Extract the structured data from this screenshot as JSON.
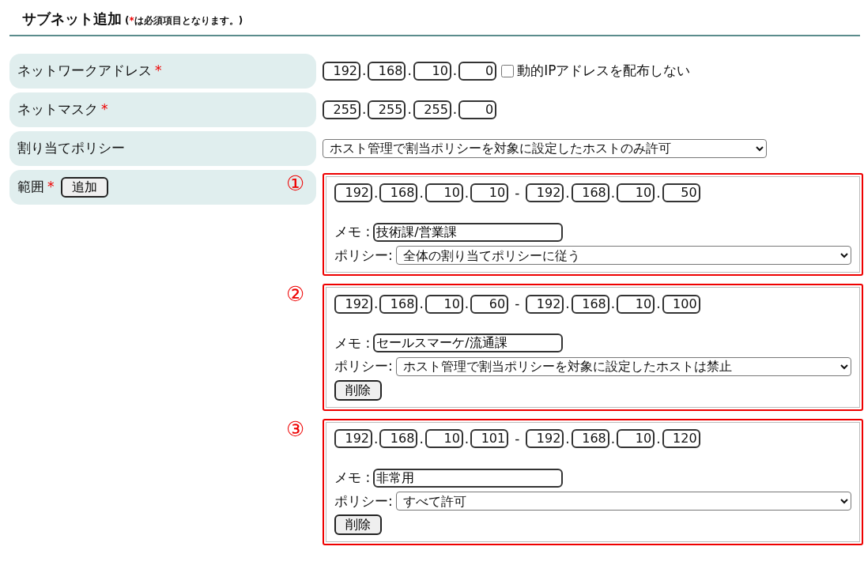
{
  "header": {
    "title": "サブネット追加",
    "note": {
      "open": "(",
      "mark": "*",
      "text": "は必須項目となります。)"
    }
  },
  "fields": [
    {
      "kind": "address",
      "label": "ネットワークアドレス",
      "required_mark": "*",
      "address": {
        "octets": [
          "192",
          "168",
          "10",
          "0"
        ],
        "separators": [
          ".",
          ".",
          "."
        ]
      },
      "checkbox": {
        "label": "動的IPアドレスを配布しない",
        "checked": false
      }
    },
    {
      "kind": "address",
      "label": "ネットマスク",
      "required_mark": "*",
      "address": {
        "octets": [
          "255",
          "255",
          "255",
          "0"
        ],
        "separators": [
          ".",
          ".",
          "."
        ]
      }
    },
    {
      "kind": "select",
      "label": "割り当てポリシー",
      "value": "ホスト管理で割当ポリシーを対象に設定したホストのみ許可"
    },
    {
      "kind": "ranges",
      "label": "範囲",
      "required_mark": "*",
      "add_button": "追加"
    }
  ],
  "ranges": [
    {
      "marker": "①",
      "start": {
        "octets": [
          "192",
          "168",
          "10",
          "10"
        ],
        "separators": [
          ".",
          ".",
          "."
        ]
      },
      "dash": "-",
      "end": {
        "octets": [
          "192",
          "168",
          "10",
          "50"
        ],
        "separators": [
          ".",
          ".",
          "."
        ]
      },
      "memo_label": "メモ :",
      "memo": "技術課/営業課",
      "policy_label": "ポリシー:",
      "policy": "全体の割り当てポリシーに従う"
    },
    {
      "marker": "②",
      "start": {
        "octets": [
          "192",
          "168",
          "10",
          "60"
        ],
        "separators": [
          ".",
          ".",
          "."
        ]
      },
      "dash": "-",
      "end": {
        "octets": [
          "192",
          "168",
          "10",
          "100"
        ],
        "separators": [
          ".",
          ".",
          "."
        ]
      },
      "memo_label": "メモ :",
      "memo": "セールスマーケ/流通課",
      "policy_label": "ポリシー:",
      "policy": "ホスト管理で割当ポリシーを対象に設定したホストは禁止",
      "delete_button": "削除"
    },
    {
      "marker": "③",
      "start": {
        "octets": [
          "192",
          "168",
          "10",
          "101"
        ],
        "separators": [
          ".",
          ".",
          "."
        ]
      },
      "dash": "-",
      "end": {
        "octets": [
          "192",
          "168",
          "10",
          "120"
        ],
        "separators": [
          ".",
          ".",
          "."
        ]
      },
      "memo_label": "メモ :",
      "memo": "非常用",
      "policy_label": "ポリシー:",
      "policy": "すべて許可",
      "delete_button": "削除"
    }
  ]
}
